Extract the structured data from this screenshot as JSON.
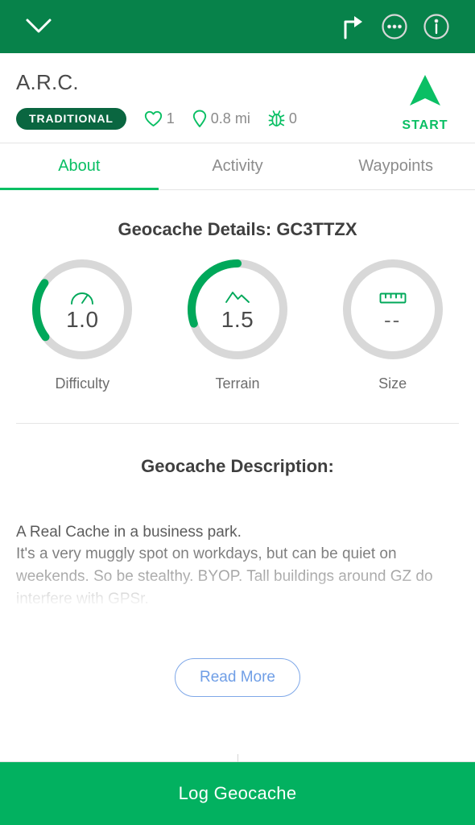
{
  "topbar": {
    "background": "#07824A",
    "icons": [
      {
        "name": "chevron-down-icon",
        "label": "Collapse"
      },
      {
        "name": "directions-arrow-icon",
        "label": "Directions"
      },
      {
        "name": "more-options-icon",
        "label": "More options"
      },
      {
        "name": "info-icon",
        "label": "Info"
      }
    ]
  },
  "header": {
    "title": "A.R.C.",
    "badge": "TRADITIONAL",
    "favorites": {
      "icon": "heart-icon",
      "value": "1"
    },
    "distance": {
      "icon": "location-pin-icon",
      "value": "0.8 mi"
    },
    "trackables": {
      "icon": "travel-bug-icon",
      "value": "0"
    },
    "start": {
      "label": "START",
      "icon": "navigation-arrow-icon",
      "color": "#0ABF64"
    }
  },
  "tabs": [
    {
      "label": "About",
      "active": true
    },
    {
      "label": "Activity",
      "active": false
    },
    {
      "label": "Waypoints",
      "active": false
    }
  ],
  "details": {
    "heading": "Geocache Details: GC3TTZX",
    "code": "GC3TTZX",
    "accent": "#00A85A",
    "track_color": "#d8d8d8",
    "rings": [
      {
        "label": "Difficulty",
        "value": "1.0",
        "numeric": 1.0,
        "max": 5,
        "icon": "gauge-icon",
        "percent": 20
      },
      {
        "label": "Terrain",
        "value": "1.5",
        "numeric": 1.5,
        "max": 5,
        "icon": "mountain-icon",
        "percent": 30
      },
      {
        "label": "Size",
        "value": "--",
        "numeric": null,
        "max": 5,
        "icon": "ruler-icon",
        "percent": 0
      }
    ]
  },
  "description": {
    "heading": "Geocache Description:",
    "body": "A Real Cache in a business park.\nIt's a very muggly spot on workdays, but can be quiet on weekends. So be stealthy. BYOP. Tall buildings around GZ do interfere with GPSr.",
    "read_more_label": "Read More",
    "read_more_color": "#6f9ee6"
  },
  "bottom": {
    "log_label": "Log Geocache",
    "background": "#02B160"
  }
}
